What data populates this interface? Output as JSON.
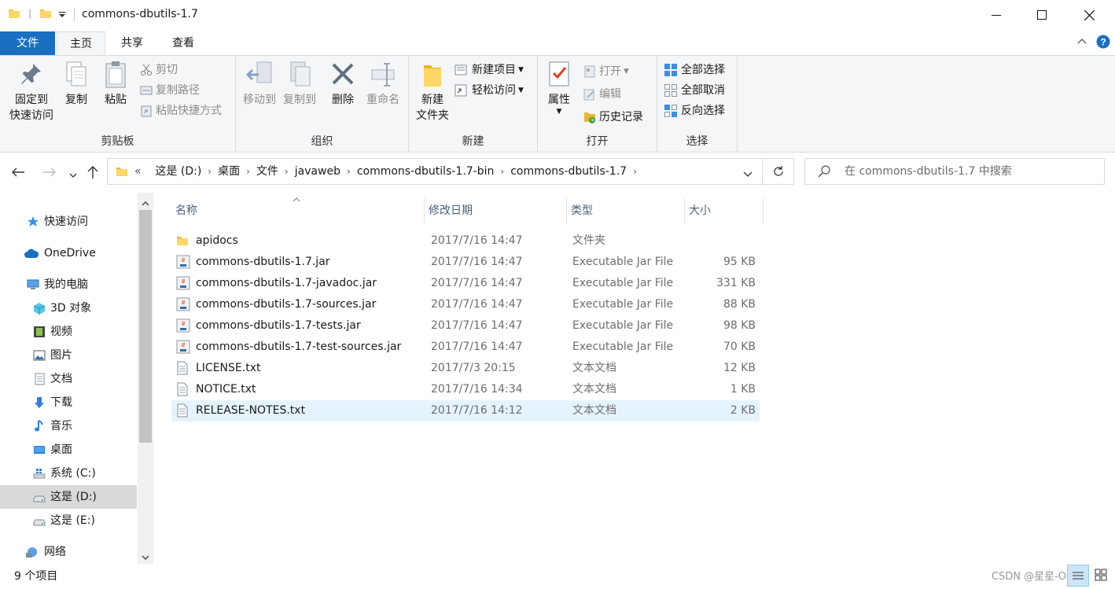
{
  "window": {
    "title": "commons-dbutils-1.7",
    "controls": [
      "minimize",
      "maximize",
      "close"
    ]
  },
  "ribbon_tabs": {
    "file": "文件",
    "home": "主页",
    "share": "共享",
    "view": "查看",
    "active": "主页"
  },
  "ribbon": {
    "clipboard": {
      "label": "剪贴板",
      "pin_line1": "固定到",
      "pin_line2": "快速访问",
      "copy": "复制",
      "paste": "粘贴",
      "cut": "剪切",
      "copy_path": "复制路径",
      "paste_shortcut": "粘贴快捷方式"
    },
    "organize": {
      "label": "组织",
      "move_to": "移动到",
      "copy_to": "复制到",
      "delete": "删除",
      "rename": "重命名"
    },
    "new": {
      "label": "新建",
      "new_folder_line1": "新建",
      "new_folder_line2": "文件夹",
      "new_item": "新建项目",
      "easy_access": "轻松访问"
    },
    "open": {
      "label": "打开",
      "properties": "属性",
      "open": "打开",
      "edit": "编辑",
      "history": "历史记录"
    },
    "select": {
      "label": "选择",
      "select_all": "全部选择",
      "select_none": "全部取消",
      "invert": "反向选择"
    }
  },
  "address": {
    "crumbs": [
      "这是 (D:)",
      "桌面",
      "文件",
      "javaweb",
      "commons-dbutils-1.7-bin",
      "commons-dbutils-1.7"
    ],
    "overflow": "«"
  },
  "search": {
    "placeholder": "在 commons-dbutils-1.7 中搜索"
  },
  "sidebar": {
    "items": [
      {
        "label": "快速访问",
        "icon": "star-icon",
        "selected": false
      },
      {
        "label": "OneDrive",
        "icon": "cloud-icon",
        "selected": false
      },
      {
        "label": "我的电脑",
        "icon": "computer-icon",
        "selected": false
      },
      {
        "label": "3D 对象",
        "icon": "cube-icon",
        "selected": false
      },
      {
        "label": "视频",
        "icon": "film-icon",
        "selected": false
      },
      {
        "label": "图片",
        "icon": "picture-icon",
        "selected": false
      },
      {
        "label": "文档",
        "icon": "document-icon",
        "selected": false
      },
      {
        "label": "下载",
        "icon": "download-arrow-icon",
        "selected": false
      },
      {
        "label": "音乐",
        "icon": "music-note-icon",
        "selected": false
      },
      {
        "label": "桌面",
        "icon": "desktop-icon",
        "selected": false
      },
      {
        "label": "系统 (C:)",
        "icon": "windows-drive-icon",
        "selected": false
      },
      {
        "label": "这是 (D:)",
        "icon": "drive-icon",
        "selected": true
      },
      {
        "label": "这是 (E:)",
        "icon": "drive-icon",
        "selected": false
      },
      {
        "label": "网络",
        "icon": "network-icon",
        "selected": false
      }
    ]
  },
  "columns": {
    "name": "名称",
    "date": "修改日期",
    "type": "类型",
    "size": "大小"
  },
  "files": [
    {
      "name": "apidocs",
      "date": "2017/7/16 14:47",
      "type": "文件夹",
      "size": "",
      "icon": "folder-icon",
      "selected": false
    },
    {
      "name": "commons-dbutils-1.7.jar",
      "date": "2017/7/16 14:47",
      "type": "Executable Jar File",
      "size": "95 KB",
      "icon": "jar-icon",
      "selected": false
    },
    {
      "name": "commons-dbutils-1.7-javadoc.jar",
      "date": "2017/7/16 14:47",
      "type": "Executable Jar File",
      "size": "331 KB",
      "icon": "jar-icon",
      "selected": false
    },
    {
      "name": "commons-dbutils-1.7-sources.jar",
      "date": "2017/7/16 14:47",
      "type": "Executable Jar File",
      "size": "88 KB",
      "icon": "jar-icon",
      "selected": false
    },
    {
      "name": "commons-dbutils-1.7-tests.jar",
      "date": "2017/7/16 14:47",
      "type": "Executable Jar File",
      "size": "98 KB",
      "icon": "jar-icon",
      "selected": false
    },
    {
      "name": "commons-dbutils-1.7-test-sources.jar",
      "date": "2017/7/16 14:47",
      "type": "Executable Jar File",
      "size": "70 KB",
      "icon": "jar-icon",
      "selected": false
    },
    {
      "name": "LICENSE.txt",
      "date": "2017/7/3 20:15",
      "type": "文本文档",
      "size": "12 KB",
      "icon": "text-file-icon",
      "selected": false
    },
    {
      "name": "NOTICE.txt",
      "date": "2017/7/16 14:34",
      "type": "文本文档",
      "size": "1 KB",
      "icon": "text-file-icon",
      "selected": false
    },
    {
      "name": "RELEASE-NOTES.txt",
      "date": "2017/7/16 14:12",
      "type": "文本文档",
      "size": "2 KB",
      "icon": "text-file-icon",
      "selected": true
    }
  ],
  "status": {
    "count": "9 个项目",
    "watermark": "CSDN @星星-Oo"
  },
  "colors": {
    "accent": "#1a6fc2",
    "ribbon_bg": "#f5f6f7",
    "selection": "#e5f3ff",
    "sidebar_selection": "#d9d9d9",
    "folder": "#f4c542"
  }
}
